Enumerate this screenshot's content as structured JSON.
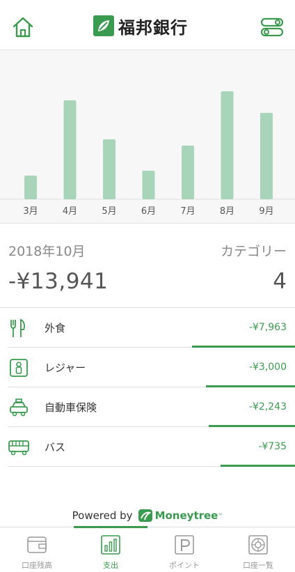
{
  "header": {
    "bank_name": "福邦銀行"
  },
  "chart_data": {
    "type": "bar",
    "categories": [
      "3月",
      "4月",
      "5月",
      "6月",
      "7月",
      "8月",
      "9月"
    ],
    "values": [
      34,
      142,
      86,
      41,
      77,
      155,
      124
    ],
    "ylim": [
      0,
      160
    ],
    "color": "#a8d5b9"
  },
  "summary": {
    "period": "2018年10月",
    "category_label": "カテゴリー",
    "total": "-¥13,941",
    "category_count": "4"
  },
  "categories": [
    {
      "name": "外食",
      "amount": "-¥7,963",
      "share": 0.36,
      "icon": "utensils-icon"
    },
    {
      "name": "レジャー",
      "amount": "-¥3,000",
      "share": 0.31,
      "icon": "person-icon"
    },
    {
      "name": "自動車保険",
      "amount": "-¥2,243",
      "share": 0.3,
      "icon": "car-icon"
    },
    {
      "name": "バス",
      "amount": "-¥735",
      "share": 0.26,
      "icon": "bus-icon"
    }
  ],
  "powered": {
    "label": "Powered by",
    "brand": "Moneytree",
    "tm": "™"
  },
  "tabs": [
    {
      "label": "口座残高",
      "icon": "wallet-icon",
      "active": false
    },
    {
      "label": "支出",
      "icon": "bar-chart-icon",
      "active": true
    },
    {
      "label": "ポイント",
      "icon": "points-icon",
      "active": false
    },
    {
      "label": "口座一覧",
      "icon": "accounts-icon",
      "active": false
    }
  ],
  "colors": {
    "accent": "#3a9a4f",
    "bar": "#a8d5b9"
  }
}
